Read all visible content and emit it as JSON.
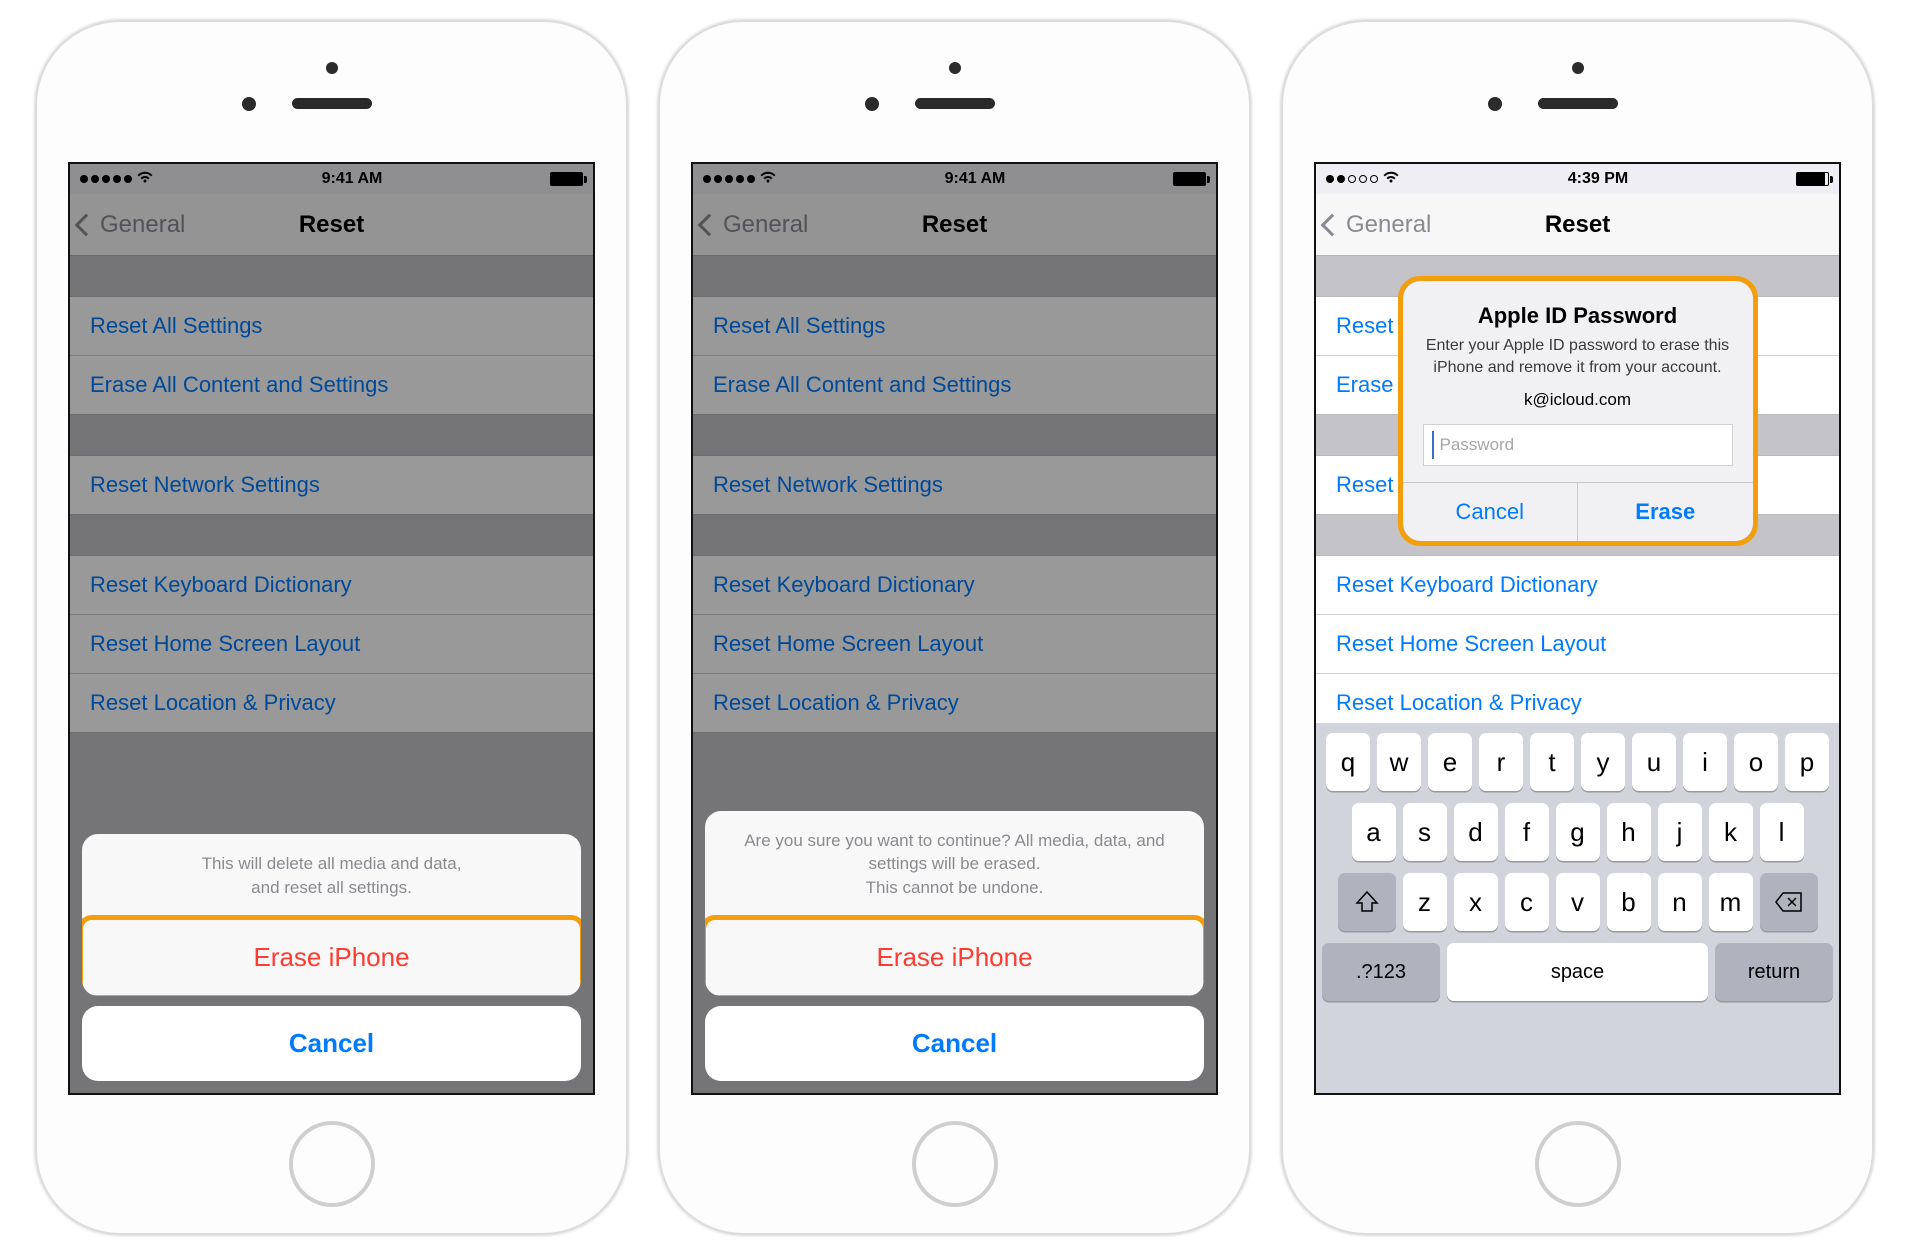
{
  "status1": {
    "time": "9:41 AM"
  },
  "status2": {
    "time": "9:41 AM"
  },
  "status3": {
    "time": "4:39 PM"
  },
  "nav": {
    "back": "General",
    "title": "Reset"
  },
  "reset": {
    "group1": [
      "Reset All Settings",
      "Erase All Content and Settings"
    ],
    "group2": [
      "Reset Network Settings"
    ],
    "group3": [
      "Reset Keyboard Dictionary",
      "Reset Home Screen Layout",
      "Reset Location & Privacy"
    ]
  },
  "sheet1": {
    "msg_l1": "This will delete all media and data,",
    "msg_l2": "and reset all settings.",
    "erase": "Erase iPhone",
    "cancel": "Cancel"
  },
  "sheet2": {
    "msg_l1": "Are you sure you want to continue? All media, data, and",
    "msg_l2": "settings will be erased.",
    "msg_l3": "This cannot be undone.",
    "erase": "Erase iPhone",
    "cancel": "Cancel"
  },
  "alert": {
    "title": "Apple ID Password",
    "msg": "Enter your Apple ID password to erase this iPhone and remove it from your account.",
    "email": "k@icloud.com",
    "placeholder": "Password",
    "cancel": "Cancel",
    "erase": "Erase"
  },
  "kb": {
    "r1": [
      "q",
      "w",
      "e",
      "r",
      "t",
      "y",
      "u",
      "i",
      "o",
      "p"
    ],
    "r2": [
      "a",
      "s",
      "d",
      "f",
      "g",
      "h",
      "j",
      "k",
      "l"
    ],
    "r3": [
      "z",
      "x",
      "c",
      "v",
      "b",
      "n",
      "m"
    ],
    "nums": ".?123",
    "space": "space",
    "ret": "return"
  }
}
